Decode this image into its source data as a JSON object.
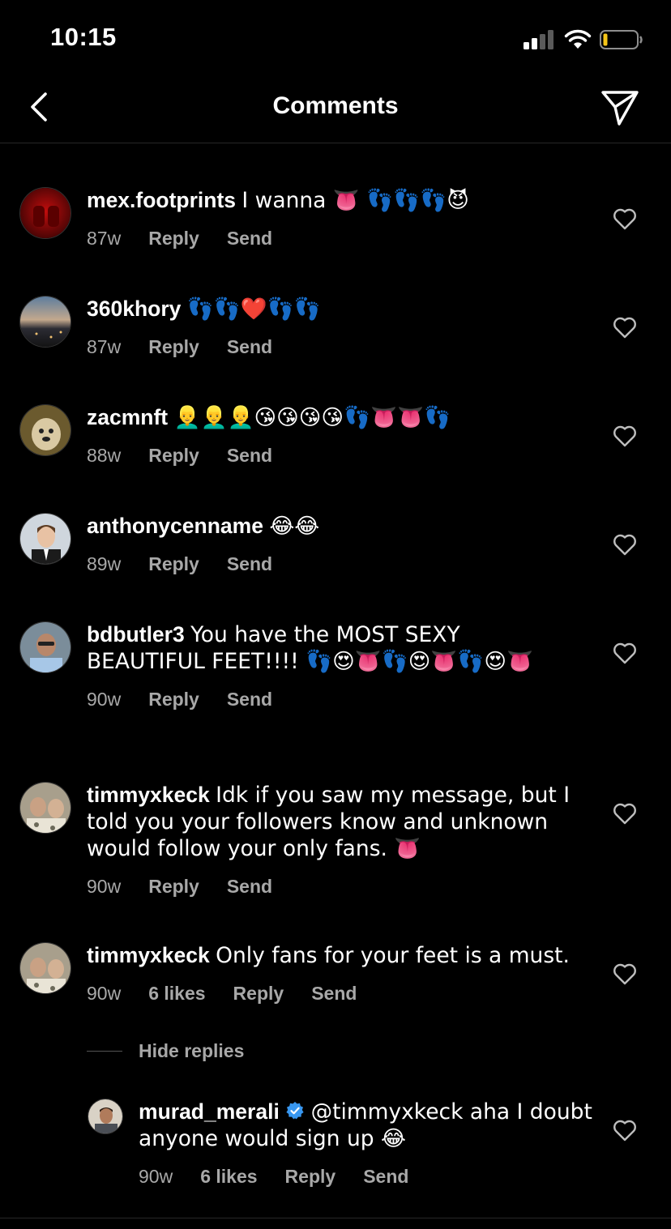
{
  "status": {
    "time": "10:15"
  },
  "header": {
    "title": "Comments"
  },
  "comments": [
    {
      "user": "mex.footprints",
      "text": "I wanna 👅 👣👣👣😈",
      "time": "87w",
      "likes": "",
      "reply": "Reply",
      "send": "Send"
    },
    {
      "user": "360khory",
      "text": "👣👣❤️👣👣",
      "time": "87w",
      "likes": "",
      "reply": "Reply",
      "send": "Send"
    },
    {
      "user": "zacmnft",
      "text": "👱‍♂️👱‍♂️👱‍♂️😘😘😘😘👣👅👅👣",
      "time": "88w",
      "likes": "",
      "reply": "Reply",
      "send": "Send"
    },
    {
      "user": "anthonycenname",
      "text": "😂😂",
      "time": "89w",
      "likes": "",
      "reply": "Reply",
      "send": "Send"
    },
    {
      "user": "bdbutler3",
      "text": "You have the MOST SEXY BEAUTIFUL FEET!!!! 👣😍👅👣😍👅👣😍👅",
      "time": "90w",
      "likes": "",
      "reply": "Reply",
      "send": "Send"
    },
    {
      "user": "timmyxkeck",
      "text": "Idk if you saw my message, but I told you your followers know and unknown would follow your only fans. 👅",
      "time": "90w",
      "likes": "",
      "reply": "Reply",
      "send": "Send"
    },
    {
      "user": "timmyxkeck",
      "text": "Only fans for your feet is a must.",
      "time": "90w",
      "likes": "6 likes",
      "reply": "Reply",
      "send": "Send"
    }
  ],
  "hide_replies": "Hide replies",
  "reply": {
    "user": "murad_merali",
    "verified": true,
    "text": "@timmyxkeck aha I doubt anyone would sign up 😂",
    "time": "90w",
    "likes": "6 likes",
    "reply": "Reply",
    "send": "Send"
  }
}
